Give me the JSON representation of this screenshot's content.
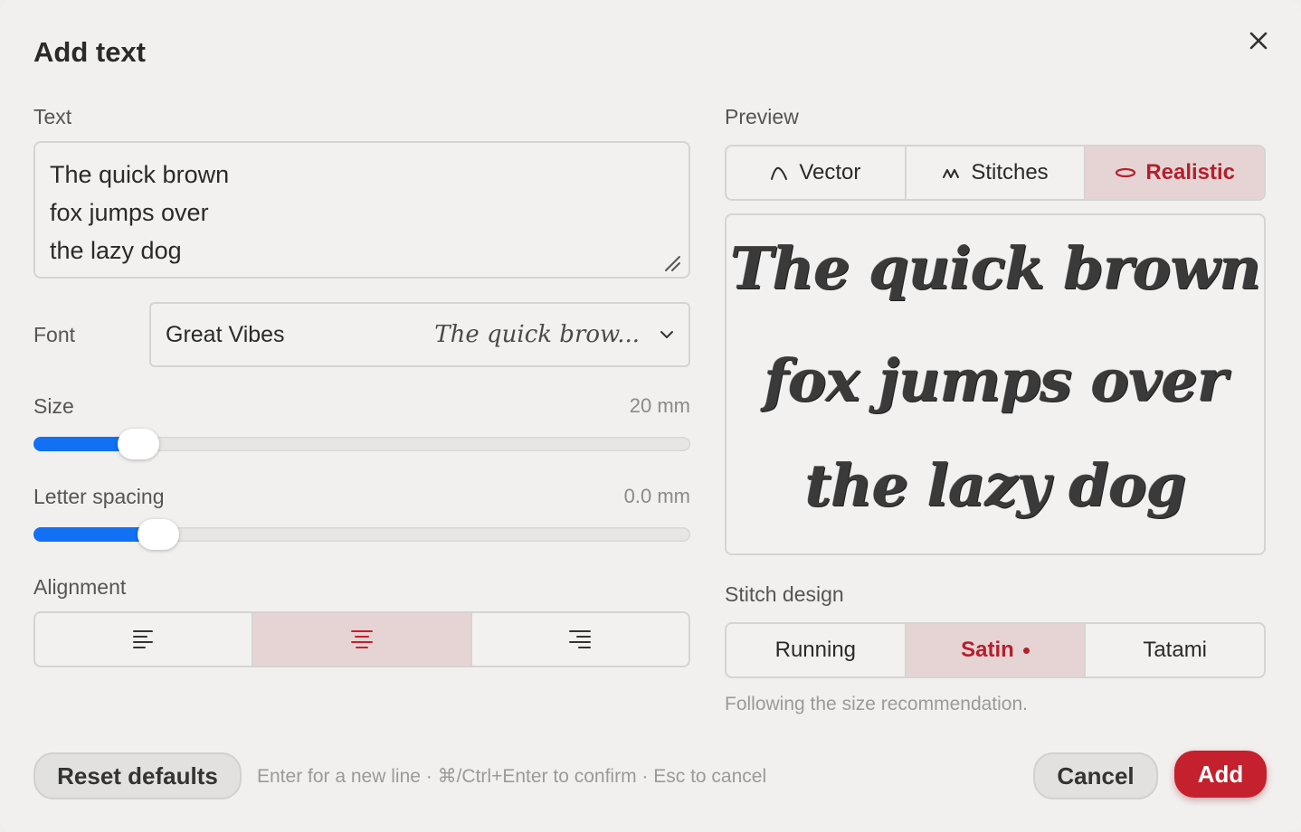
{
  "dialog": {
    "title": "Add text"
  },
  "text_field": {
    "label": "Text",
    "value": "The quick brown\nfox jumps over\nthe lazy dog"
  },
  "font": {
    "label": "Font",
    "selected": "Great Vibes",
    "sample": "The quick brow..."
  },
  "size": {
    "label": "Size",
    "value_text": "20 mm",
    "fraction": 0.16
  },
  "letter_spacing": {
    "label": "Letter spacing",
    "value_text": "0.0 mm",
    "fraction": 0.19
  },
  "alignment": {
    "label": "Alignment",
    "options": [
      "left",
      "center",
      "right"
    ],
    "selected": "center"
  },
  "preview": {
    "label": "Preview",
    "modes": [
      {
        "label": "Vector",
        "icon": "vector-curve-icon"
      },
      {
        "label": "Stitches",
        "icon": "stitches-zigzag-icon"
      },
      {
        "label": "Realistic",
        "icon": "realistic-thread-icon"
      }
    ],
    "selected_mode": "Realistic",
    "lines": [
      "The quick brown",
      "fox jumps over",
      "the lazy dog"
    ]
  },
  "stitch_design": {
    "label": "Stitch design",
    "options": [
      "Running",
      "Satin",
      "Tatami"
    ],
    "selected": "Satin",
    "note": "Following the size recommendation."
  },
  "footer": {
    "reset_label": "Reset defaults",
    "hint": "Enter for a new line · ⌘/Ctrl+Enter to confirm · Esc to cancel",
    "cancel_label": "Cancel",
    "add_label": "Add"
  },
  "colors": {
    "accent": "#c4202e",
    "active_bg": "#e6d4d4",
    "slider_fill": "#1270f5"
  }
}
